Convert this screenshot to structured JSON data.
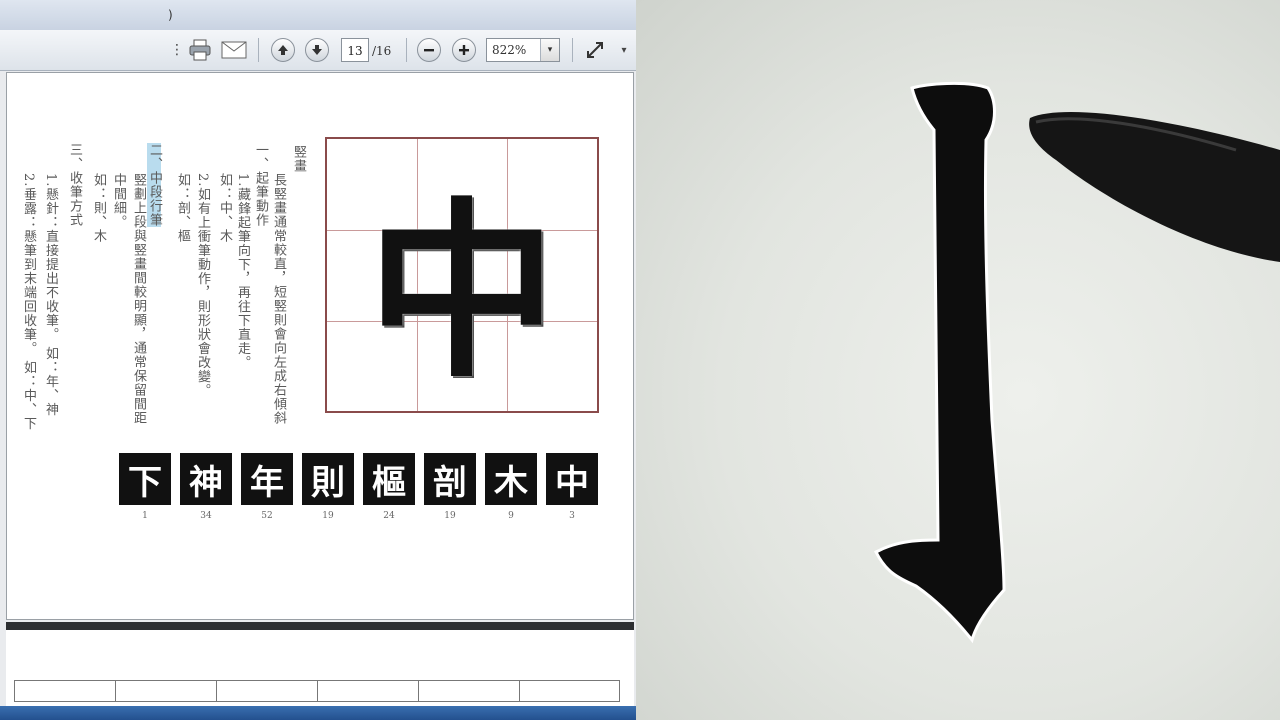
{
  "viewer": {
    "page_current": "13",
    "page_total": "/16",
    "zoom": "822%",
    "zoom_caret": "▾"
  },
  "doc": {
    "columns": [
      "竪畫",
      "長竪畫通常較直，短竪則會向左成右傾斜",
      "一、起筆動作",
      "1.藏鋒起筆向下，再往下直走。",
      "如：中、木",
      "2.如有上衝筆動作，則形狀會改變。",
      "如：剖、樞",
      "二、中段行筆",
      "竪劃上段與竪畫間較明顯，通常保留間距",
      "中間細。",
      "如：則、木",
      "三、收筆方式",
      "1.懸針：直接提出不收筆。  如：年、神",
      "2.垂露：懸筆到末端回收筆。  如：中、下"
    ],
    "main_char": "中",
    "tiles": [
      {
        "char": "下",
        "num": "1"
      },
      {
        "char": "神",
        "num": "34"
      },
      {
        "char": "年",
        "num": "52"
      },
      {
        "char": "則",
        "num": "19"
      },
      {
        "char": "樞",
        "num": "24"
      },
      {
        "char": "剖",
        "num": "19"
      },
      {
        "char": "木",
        "num": "9"
      },
      {
        "char": "中",
        "num": "3"
      }
    ]
  }
}
